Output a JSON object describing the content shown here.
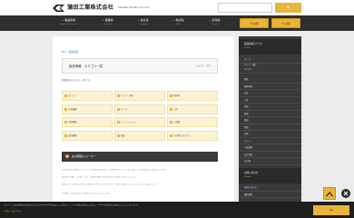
{
  "header": {
    "logo_jp": "蒲田工業株式会社",
    "logo_en": "Kamata Industry Co.,Ltd.",
    "search_placeholder": "",
    "search_button": "検"
  },
  "gnav": {
    "items": [
      {
        "jp": "製品情報",
        "en": "Product Information"
      },
      {
        "jp": "事業案",
        "en": "Business"
      },
      {
        "jp": "会社案",
        "en": "Company"
      },
      {
        "jp": "拠点案",
        "en": "Office"
      },
      {
        "jp": "採用案",
        "en": "Recruit"
      }
    ],
    "button_1": "お問",
    "button_2": "お問"
  },
  "main": {
    "breadcrumb": "HP ＞ 製品情報",
    "title": "製品情報　カテゴリ一覧",
    "title_right": "カテゴリ一覧へ",
    "intro": "掲載製品のカテゴリ一覧です。",
    "grid": [
      [
        "ポンプ",
        "バルブ・継手",
        "配管材"
      ],
      [
        "計装機器",
        "ホース",
        "工具"
      ],
      [
        "空調機器",
        "クリーンルーム",
        "ろ過機"
      ],
      [
        "環境機器",
        "搬送",
        "その他のカテゴリ"
      ]
    ],
    "section_title": "主な取扱いメーカー",
    "paragraphs": [
      "当社は国内外の優れたメーカーと代理店契約を結び、お客様の様々なニーズにお応えできる製品をご提案いたします。",
      "各製品の詳細につきましては、お気軽に最寄りの営業所までお問い合わせください。",
      "掲載されている製品以外にも多数取り扱っておりますので、お探しの製品がございましたらご相談ください。",
      "※ 価格・仕様は予告なく変更になる場合がございます。"
    ]
  },
  "sidebar": {
    "head_1": {
      "jp": "製品情報カテゴリ",
      "en": "Search"
    },
    "head_1_items": [
      "ポンプ",
      "バルブ・継手",
      "Section"
    ],
    "list": [
      "配管",
      "配管材料",
      "計装",
      "工具",
      "空調",
      "清掃",
      "搬送",
      "環境",
      "計測",
      "クリーン",
      "ろ過装置",
      "安全用品",
      "その他",
      "電気",
      "梱包材",
      "メーカー一覧"
    ],
    "head_2": {
      "jp": "お問い合わせ",
      "en": "Contact"
    },
    "head_2_items": [
      "お問い合わせ",
      "資料請求"
    ]
  },
  "cookie": {
    "message": "当サイトではお客様の利便性向上のためCookieを使用しています。サイトの閲覧を続けた場合、Cookieの使用に同意したことになります。",
    "link": "» 詳しくはこちら",
    "ok_button": "OK"
  },
  "colors": {
    "accent": "#e8b53a",
    "nav_bg": "#2e2e2e",
    "page_bg": "#ececec"
  }
}
